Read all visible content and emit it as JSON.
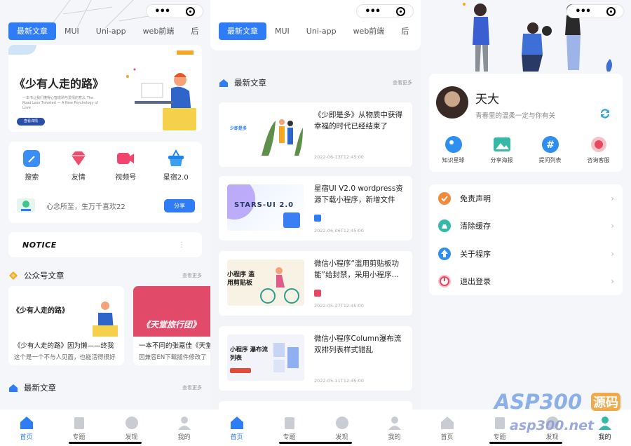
{
  "colors": {
    "primary": "#2e7cf6",
    "orange": "#f5a623",
    "accent_red": "#e8475f"
  },
  "capsule": {
    "dots": "•••",
    "ring_icon": "target-icon"
  },
  "tabs": [
    "最新文章",
    "MUI",
    "Uni-app",
    "web前端",
    "后"
  ],
  "screen1": {
    "hero": {
      "title": "《少有人走的路》",
      "subtitle": "一本书让我们懂得心智成熟与爱情的意义 The Road Less Traveled — A New Psychology of Love",
      "button": "查看详情"
    },
    "shortcuts": [
      {
        "label": "搜索",
        "icon": "search-edit-icon"
      },
      {
        "label": "友情",
        "icon": "diamond-icon"
      },
      {
        "label": "视频号",
        "icon": "video-icon"
      },
      {
        "label": "星宿2.0",
        "icon": "basket-icon"
      }
    ],
    "share": {
      "text": "心念所至，生万千喜欢22",
      "button": "分享"
    },
    "notice": {
      "label": "NOTICE"
    },
    "gzh_section": {
      "title": "公众号文章",
      "more": "查看更多"
    },
    "gzh_cards": [
      {
        "img_title": "《少有人走的路》",
        "title": "《少有人走的路》因为懒——终我",
        "desc": "这个是一个不与人见面，也能活得很好"
      },
      {
        "img_title": "《天堂旅行团》",
        "title": "一本不同的张嘉佳《天堂",
        "desc": "因兼容EN下载插件修改了"
      }
    ],
    "latest_section": {
      "title": "最新文章",
      "more": "查看更多"
    }
  },
  "screen2": {
    "section": {
      "title": "最新文章",
      "more": "查看更多"
    },
    "articles": [
      {
        "title": "《少即是多》从物质中获得幸福的时代已经结束了",
        "date": "2022-06-13T12:45:00",
        "thumb_text": "少即是多"
      },
      {
        "title": "星宿UI V2.0 wordpress资源下载小程序，新增文件下…",
        "date": "2022-06-06T12:45:00",
        "thumb_text": "STARS-UI 2.0"
      },
      {
        "title": "微信小程序“滥用剪贴板功能”给封禁，采用小程序…",
        "date": "2022-05-27T12:45:00",
        "thumb_text": "小程序 滥用剪贴板"
      },
      {
        "title": "微信小程序Column瀑布流双排列表样式错乱",
        "date": "2022-05-11T12:45:00",
        "thumb_text": "小程序 瀑布流列表"
      }
    ]
  },
  "screen3": {
    "profile": {
      "name": "天大",
      "bio": "青春里的温柔一定与你有关"
    },
    "features": [
      {
        "label": "知识星球",
        "icon": "planet-icon"
      },
      {
        "label": "分享海报",
        "icon": "image-icon"
      },
      {
        "label": "提问列表",
        "icon": "hashtag-icon"
      },
      {
        "label": "咨询客服",
        "icon": "support-icon"
      }
    ],
    "menu": [
      {
        "label": "免责声明",
        "icon": "disclaimer-icon"
      },
      {
        "label": "清除缓存",
        "icon": "clean-icon"
      },
      {
        "label": "关于程序",
        "icon": "upload-arrow-icon"
      },
      {
        "label": "退出登录",
        "icon": "power-icon"
      }
    ]
  },
  "bottom_nav": [
    "首页",
    "专题",
    "发现",
    "我的"
  ],
  "watermark": {
    "line1": "ASP300",
    "tag": "源码",
    "line2": "asp300.net"
  }
}
